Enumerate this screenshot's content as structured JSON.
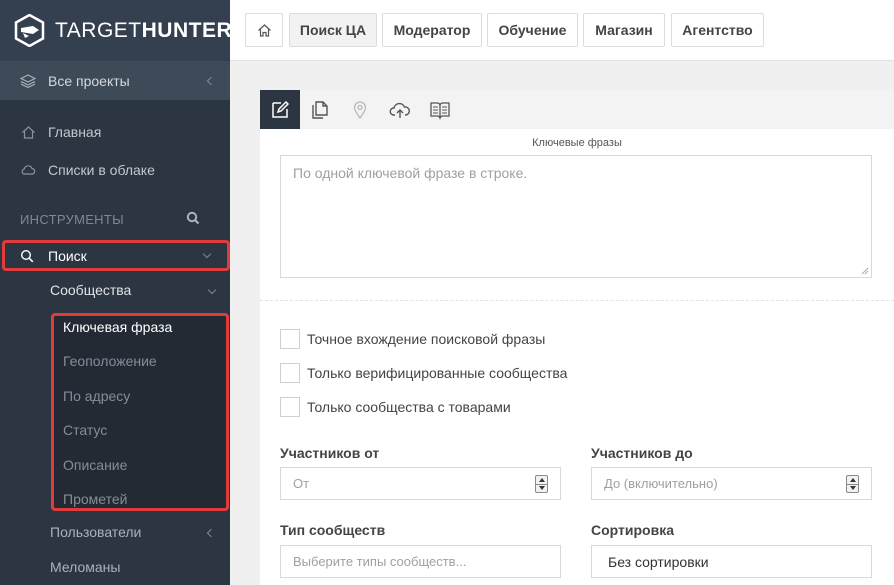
{
  "brand": {
    "name_thin": "TARGET",
    "name_bold": "HUNTER"
  },
  "sidebar": {
    "all_projects": "Все проекты",
    "home": "Главная",
    "cloud_lists": "Списки в облаке",
    "tools_header": "ИНСТРУМЕНТЫ",
    "search": "Поиск",
    "communities": "Сообщества",
    "search_options": [
      "Ключевая фраза",
      "Геоположение",
      "По адресу",
      "Статус",
      "Описание",
      "Прометей"
    ],
    "users": "Пользователи",
    "music_lovers": "Меломаны"
  },
  "topbar": {
    "tabs": [
      "Поиск ЦА",
      "Модератор",
      "Обучение",
      "Магазин",
      "Агентство"
    ],
    "active_tab": "Поиск ЦА"
  },
  "form": {
    "keywords_label": "Ключевые фразы",
    "keywords_placeholder": "По одной ключевой фразе в строке.",
    "checkboxes": [
      "Точное вхождение поисковой фразы",
      "Только верифицированные сообщества",
      "Только сообщества с товарами"
    ],
    "members_from_label": "Участников от",
    "members_from_placeholder": "От",
    "members_to_label": "Участников до",
    "members_to_placeholder": "До (включительно)",
    "community_type_label": "Тип сообществ",
    "community_type_placeholder": "Выберите типы сообществ...",
    "sort_label": "Сортировка",
    "sort_value": "Без сортировки"
  },
  "colors": {
    "sidebar_bg": "#2c3542",
    "highlight": "#e23b3b",
    "active_tab": "#2c3542"
  },
  "icons": [
    "home-icon",
    "edit-icon",
    "documents-icon",
    "location-pin-icon",
    "cloud-upload-icon",
    "book-icon",
    "layers-icon",
    "cloud-icon",
    "search-icon"
  ]
}
